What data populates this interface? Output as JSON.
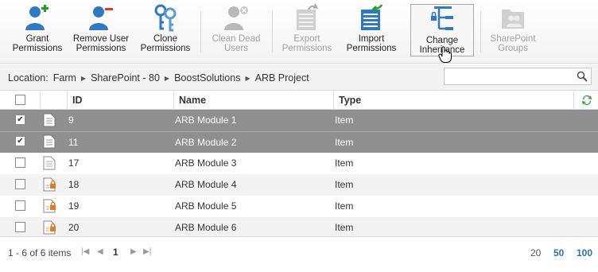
{
  "toolbar": {
    "grant": "Grant\nPermissions",
    "remove": "Remove User\nPermissions",
    "clone": "Clone\nPermissions",
    "clean": "Clean Dead\nUsers",
    "export": "Export\nPermissions",
    "import": "Import\nPermissions",
    "change": "Change\nInheritance",
    "groups": "SharePoint\nGroups"
  },
  "location": {
    "label": "Location:",
    "crumbs": [
      "Farm",
      "SharePoint - 80",
      "BoostSolutions",
      "ARB Project"
    ]
  },
  "grid": {
    "headers": {
      "id": "ID",
      "name": "Name",
      "type": "Type"
    },
    "rows": [
      {
        "id": "9",
        "name": "ARB Module 1",
        "type": "Item",
        "checked": "✔"
      },
      {
        "id": "11",
        "name": "ARB Module 2",
        "type": "Item",
        "checked": "✔"
      },
      {
        "id": "17",
        "name": "ARB Module 3",
        "type": "Item",
        "checked": ""
      },
      {
        "id": "18",
        "name": "ARB Module 4",
        "type": "Item",
        "checked": ""
      },
      {
        "id": "19",
        "name": "ARB Module 5",
        "type": "Item",
        "checked": ""
      },
      {
        "id": "20",
        "name": "ARB Module 6",
        "type": "Item",
        "checked": ""
      }
    ]
  },
  "pager": {
    "info": "1 - 6 of 6 items",
    "current": "1",
    "sizes": [
      "20",
      "50",
      "100"
    ]
  },
  "colors": {
    "accent": "#2f6fb5",
    "selected_row": "#8f8f8f"
  }
}
